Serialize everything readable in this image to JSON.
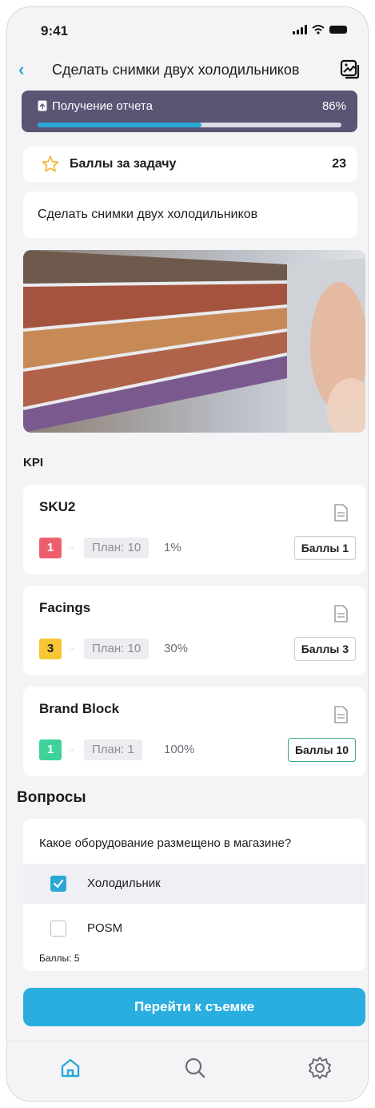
{
  "status_bar": {
    "time": "9:41"
  },
  "header": {
    "title": "Сделать снимки двух холодильников",
    "back_icon": "chevron-left-icon",
    "gallery_icon": "gallery-icon"
  },
  "progress": {
    "label": "Получение отчета",
    "percent_text": "86%",
    "fraction": 0.54
  },
  "score": {
    "label": "Баллы за задачу",
    "value": "23"
  },
  "task": {
    "text": "Сделать снимки двух холодильников"
  },
  "kpi": {
    "title": "KPI",
    "items": [
      {
        "name": "SKU2",
        "fact": "1",
        "plan": "План: 10",
        "percent": "1%",
        "points": "Баллы 1",
        "color": "#ee5f6d"
      },
      {
        "name": "Facings",
        "fact": "3",
        "plan": "План: 10",
        "percent": "30%",
        "points": "Баллы 3",
        "color": "#f8c535"
      },
      {
        "name": "Brand Block",
        "fact": "1",
        "plan": "План: 1",
        "percent": "100%",
        "points": "Баллы 10",
        "color": "#3dd39a"
      }
    ]
  },
  "questions": {
    "title": "Вопросы",
    "question": "Какое оборудование размещено в магазине?",
    "options": [
      {
        "label": "Холодильник",
        "checked": true
      },
      {
        "label": "POSM",
        "checked": false
      }
    ],
    "points": "Баллы: 5"
  },
  "cta": {
    "label": "Перейти к съемке"
  },
  "tabbar": {
    "items": [
      "home-icon",
      "search-icon",
      "settings-icon"
    ]
  },
  "colors": {
    "accent": "#2aa8d8",
    "progress_card": "#5a5575"
  }
}
